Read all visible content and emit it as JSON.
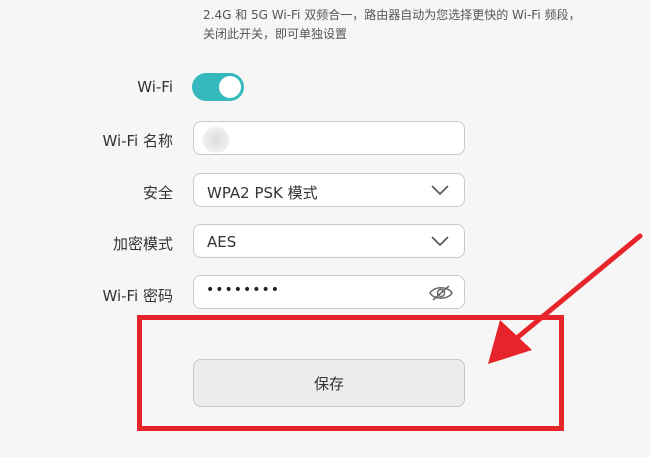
{
  "description": "2.4G 和 5G Wi-Fi 双频合一，路由器自动为您选择更快的 Wi-Fi 频段，关闭此开关，即可单独设置",
  "wifi": {
    "label": "Wi-Fi",
    "enabled": true
  },
  "ssid": {
    "label": "Wi-Fi 名称",
    "value": ""
  },
  "security": {
    "label": "安全",
    "value": "WPA2 PSK 模式"
  },
  "encryption": {
    "label": "加密模式",
    "value": "AES"
  },
  "password": {
    "label": "Wi-Fi 密码",
    "masked": "••••••••"
  },
  "save": {
    "label": "保存"
  },
  "colors": {
    "toggle_on": "#36b9bd",
    "annotation_red": "#e8242b",
    "background": "#f6f6f6"
  },
  "icons": {
    "dropdown": "chevron-down-icon",
    "visibility": "eye-slash-icon",
    "annotation": "red-arrow-icon"
  }
}
